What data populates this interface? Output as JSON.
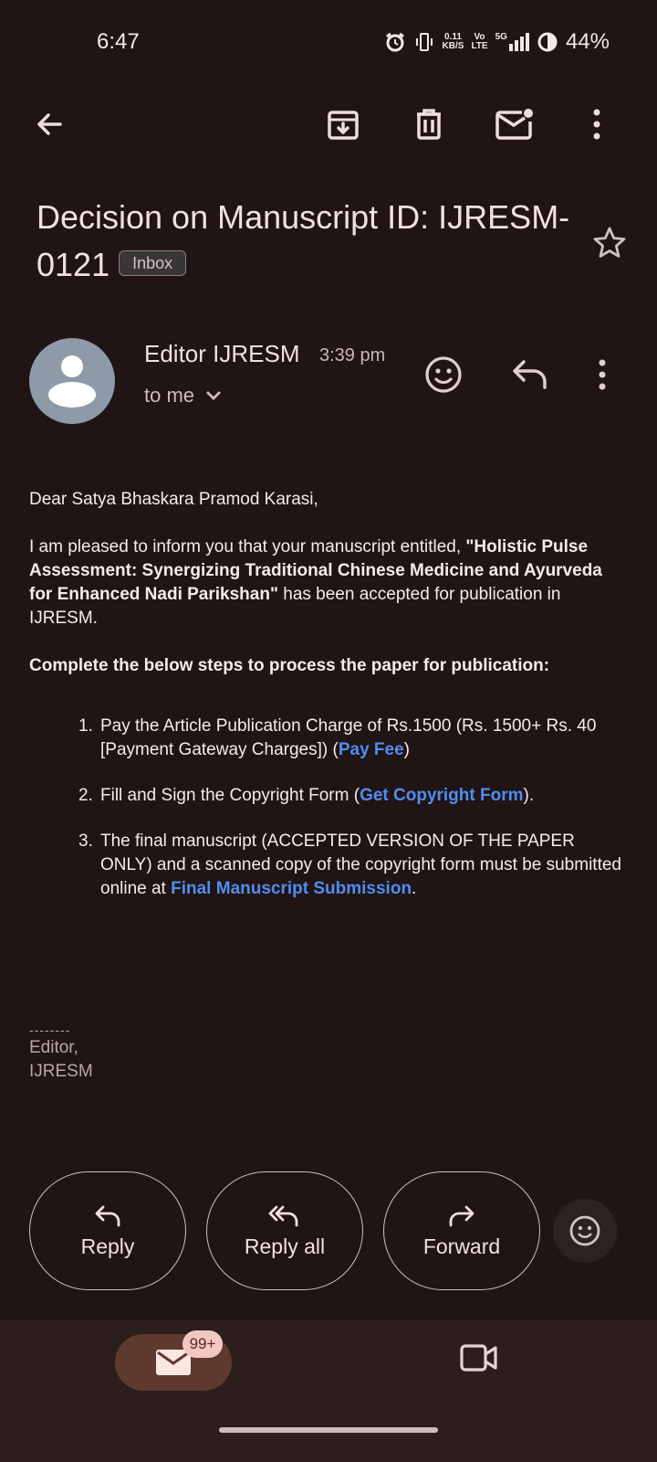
{
  "status_bar": {
    "time": "6:47",
    "net_speed_top": "0.11",
    "net_speed_bottom": "KB/S",
    "volte_top": "Vo",
    "volte_bottom": "LTE",
    "network": "5G",
    "battery": "44%"
  },
  "toolbar": {
    "back_icon": "arrow-left-icon",
    "archive_icon": "archive-icon",
    "delete_icon": "trash-icon",
    "mark_unread_icon": "mail-unread-icon",
    "more_icon": "more-vert-icon"
  },
  "subject": {
    "text": "Decision on Manuscript ID: IJRESM-0121",
    "label_badge": "Inbox"
  },
  "sender": {
    "name": "Editor IJRESM",
    "time": "3:39 pm",
    "recipient": "to me"
  },
  "body": {
    "greeting": "Dear Satya Bhaskara Pramod Karasi,",
    "para1_intro": "I am pleased to inform you that your manuscript entitled, ",
    "para1_title": "\"Holistic Pulse Assessment: Synergizing Traditional Chinese Medicine and Ayurveda for Enhanced Nadi Parikshan\"",
    "para1_end": " has been accepted for publication in IJRESM.",
    "steps_heading": "Complete the below steps to process the paper for publication:",
    "steps": [
      {
        "num": "1.",
        "text": "Pay the Article Publication Charge of Rs.1500 (Rs. 1500+ Rs. 40 [Payment Gateway Charges]) (",
        "link": "Pay Fee",
        "after": ")"
      },
      {
        "num": "2.",
        "text": "Fill and Sign the Copyright Form (",
        "link": "Get Copyright Form",
        "after": ")."
      },
      {
        "num": "3.",
        "text": "The final manuscript (ACCEPTED VERSION OF THE PAPER ONLY) and a scanned copy of the copyright form must be submitted online at ",
        "link": "Final Manuscript Submission",
        "after": "."
      }
    ],
    "signature_dashes": "--------",
    "signature_line1": "Editor,",
    "signature_line2": "IJRESM"
  },
  "actions": {
    "reply": "Reply",
    "reply_all": "Reply all",
    "forward": "Forward"
  },
  "bottom_nav": {
    "mail_badge": "99+"
  },
  "colors": {
    "background": "#201414",
    "link": "#4f8ef0",
    "nav_background": "#2b1e1d",
    "active_pill": "#5e3a2e",
    "badge": "#f3c7c1"
  }
}
